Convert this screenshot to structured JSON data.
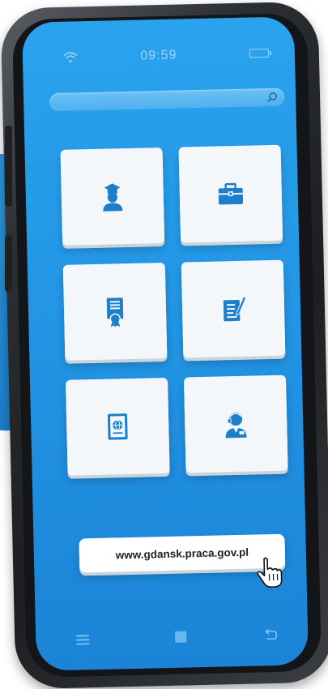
{
  "status_bar": {
    "time": "09:59",
    "wifi_icon": "wifi-icon",
    "battery_icon": "battery-icon"
  },
  "search": {
    "icon": "search-icon"
  },
  "tiles": [
    {
      "name": "education",
      "icon": "graduate-icon"
    },
    {
      "name": "jobs",
      "icon": "briefcase-icon"
    },
    {
      "name": "certificate",
      "icon": "certificate-icon"
    },
    {
      "name": "document",
      "icon": "document-edit-icon"
    },
    {
      "name": "passport",
      "icon": "passport-icon"
    },
    {
      "name": "advisor",
      "icon": "advisor-icon"
    }
  ],
  "link": {
    "url": "www.gdansk.praca.gov.pl"
  },
  "nav": {
    "menu_icon": "menu-icon",
    "home_icon": "home-icon",
    "back_icon": "back-icon"
  },
  "colors": {
    "screen": "#2294e3",
    "icon": "#1b7fc9",
    "tile": "#f4f7fa"
  }
}
